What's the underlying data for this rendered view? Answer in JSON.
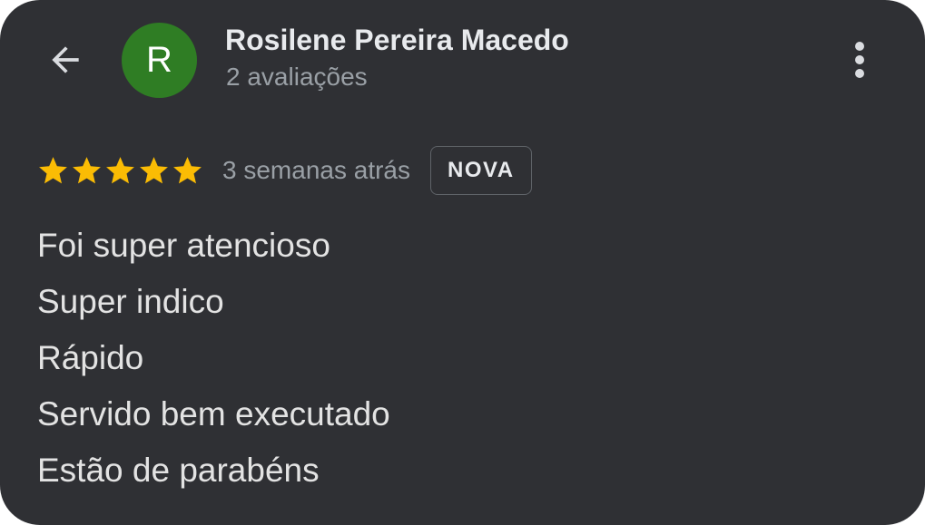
{
  "header": {
    "avatar_letter": "R",
    "avatar_color": "#2f7d24",
    "user_name": "Rosilene Pereira Macedo",
    "review_count": "2 avaliações",
    "back_icon": "arrow-left-icon",
    "more_icon": "more-vertical-icon"
  },
  "review": {
    "rating": 5,
    "rating_max": 5,
    "star_color": "#fbbc04",
    "date": "3 semanas atrás",
    "badge": "NOVA",
    "lines": [
      "Foi super atencioso",
      "Super indico",
      "Rápido",
      "Servido bem executado",
      "Estão de parabéns"
    ]
  }
}
